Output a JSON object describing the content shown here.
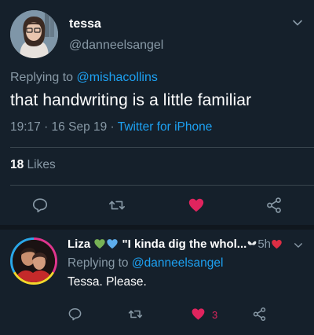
{
  "tweet": {
    "name": "tessa",
    "handle": "@danneelsangel",
    "replying_prefix": "Replying to ",
    "replying_to": "@mishacollins",
    "text": "that handwriting is a little familiar",
    "time": "19:17 · 16 Sep 19 · ",
    "source": "Twitter for iPhone",
    "likes_count": "18",
    "likes_label": " Likes",
    "actions": [
      "reply-icon",
      "retweet-icon",
      "like-icon-filled",
      "share-icon"
    ]
  },
  "reply": {
    "name": "Liza",
    "quote": "\"I kinda dig the whol...",
    "time": "5h",
    "replying_prefix": "Replying to ",
    "replying_to": "@danneelsangel",
    "text": "Tessa. Please.",
    "like_count": "3",
    "actions": [
      "reply-icon",
      "retweet-icon",
      "like-icon-filled",
      "share-icon"
    ]
  },
  "colors": {
    "background": "#15202b",
    "secondary_text": "#8899a6",
    "link": "#1da1f2",
    "like": "#e0245e",
    "divider": "#38444d"
  }
}
